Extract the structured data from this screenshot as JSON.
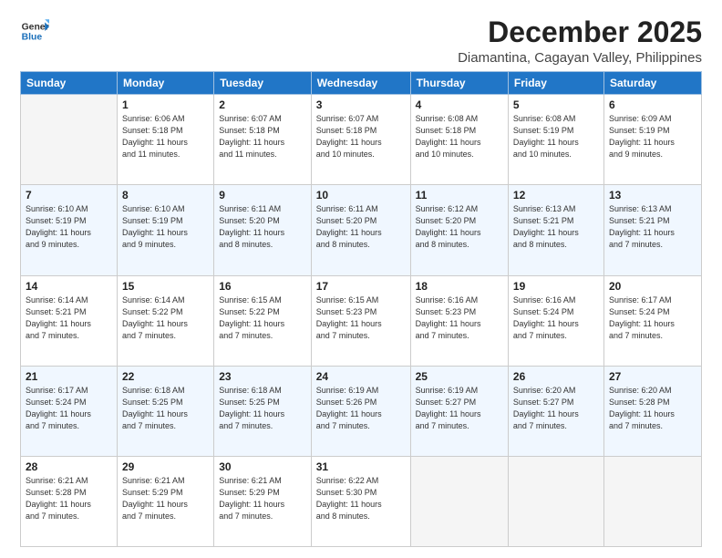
{
  "header": {
    "logo_general": "General",
    "logo_blue": "Blue",
    "month": "December 2025",
    "location": "Diamantina, Cagayan Valley, Philippines"
  },
  "days_of_week": [
    "Sunday",
    "Monday",
    "Tuesday",
    "Wednesday",
    "Thursday",
    "Friday",
    "Saturday"
  ],
  "weeks": [
    [
      {
        "day": "",
        "info": ""
      },
      {
        "day": "1",
        "info": "Sunrise: 6:06 AM\nSunset: 5:18 PM\nDaylight: 11 hours\nand 11 minutes."
      },
      {
        "day": "2",
        "info": "Sunrise: 6:07 AM\nSunset: 5:18 PM\nDaylight: 11 hours\nand 11 minutes."
      },
      {
        "day": "3",
        "info": "Sunrise: 6:07 AM\nSunset: 5:18 PM\nDaylight: 11 hours\nand 10 minutes."
      },
      {
        "day": "4",
        "info": "Sunrise: 6:08 AM\nSunset: 5:18 PM\nDaylight: 11 hours\nand 10 minutes."
      },
      {
        "day": "5",
        "info": "Sunrise: 6:08 AM\nSunset: 5:19 PM\nDaylight: 11 hours\nand 10 minutes."
      },
      {
        "day": "6",
        "info": "Sunrise: 6:09 AM\nSunset: 5:19 PM\nDaylight: 11 hours\nand 9 minutes."
      }
    ],
    [
      {
        "day": "7",
        "info": "Sunrise: 6:10 AM\nSunset: 5:19 PM\nDaylight: 11 hours\nand 9 minutes."
      },
      {
        "day": "8",
        "info": "Sunrise: 6:10 AM\nSunset: 5:19 PM\nDaylight: 11 hours\nand 9 minutes."
      },
      {
        "day": "9",
        "info": "Sunrise: 6:11 AM\nSunset: 5:20 PM\nDaylight: 11 hours\nand 8 minutes."
      },
      {
        "day": "10",
        "info": "Sunrise: 6:11 AM\nSunset: 5:20 PM\nDaylight: 11 hours\nand 8 minutes."
      },
      {
        "day": "11",
        "info": "Sunrise: 6:12 AM\nSunset: 5:20 PM\nDaylight: 11 hours\nand 8 minutes."
      },
      {
        "day": "12",
        "info": "Sunrise: 6:13 AM\nSunset: 5:21 PM\nDaylight: 11 hours\nand 8 minutes."
      },
      {
        "day": "13",
        "info": "Sunrise: 6:13 AM\nSunset: 5:21 PM\nDaylight: 11 hours\nand 7 minutes."
      }
    ],
    [
      {
        "day": "14",
        "info": "Sunrise: 6:14 AM\nSunset: 5:21 PM\nDaylight: 11 hours\nand 7 minutes."
      },
      {
        "day": "15",
        "info": "Sunrise: 6:14 AM\nSunset: 5:22 PM\nDaylight: 11 hours\nand 7 minutes."
      },
      {
        "day": "16",
        "info": "Sunrise: 6:15 AM\nSunset: 5:22 PM\nDaylight: 11 hours\nand 7 minutes."
      },
      {
        "day": "17",
        "info": "Sunrise: 6:15 AM\nSunset: 5:23 PM\nDaylight: 11 hours\nand 7 minutes."
      },
      {
        "day": "18",
        "info": "Sunrise: 6:16 AM\nSunset: 5:23 PM\nDaylight: 11 hours\nand 7 minutes."
      },
      {
        "day": "19",
        "info": "Sunrise: 6:16 AM\nSunset: 5:24 PM\nDaylight: 11 hours\nand 7 minutes."
      },
      {
        "day": "20",
        "info": "Sunrise: 6:17 AM\nSunset: 5:24 PM\nDaylight: 11 hours\nand 7 minutes."
      }
    ],
    [
      {
        "day": "21",
        "info": "Sunrise: 6:17 AM\nSunset: 5:24 PM\nDaylight: 11 hours\nand 7 minutes."
      },
      {
        "day": "22",
        "info": "Sunrise: 6:18 AM\nSunset: 5:25 PM\nDaylight: 11 hours\nand 7 minutes."
      },
      {
        "day": "23",
        "info": "Sunrise: 6:18 AM\nSunset: 5:25 PM\nDaylight: 11 hours\nand 7 minutes."
      },
      {
        "day": "24",
        "info": "Sunrise: 6:19 AM\nSunset: 5:26 PM\nDaylight: 11 hours\nand 7 minutes."
      },
      {
        "day": "25",
        "info": "Sunrise: 6:19 AM\nSunset: 5:27 PM\nDaylight: 11 hours\nand 7 minutes."
      },
      {
        "day": "26",
        "info": "Sunrise: 6:20 AM\nSunset: 5:27 PM\nDaylight: 11 hours\nand 7 minutes."
      },
      {
        "day": "27",
        "info": "Sunrise: 6:20 AM\nSunset: 5:28 PM\nDaylight: 11 hours\nand 7 minutes."
      }
    ],
    [
      {
        "day": "28",
        "info": "Sunrise: 6:21 AM\nSunset: 5:28 PM\nDaylight: 11 hours\nand 7 minutes."
      },
      {
        "day": "29",
        "info": "Sunrise: 6:21 AM\nSunset: 5:29 PM\nDaylight: 11 hours\nand 7 minutes."
      },
      {
        "day": "30",
        "info": "Sunrise: 6:21 AM\nSunset: 5:29 PM\nDaylight: 11 hours\nand 7 minutes."
      },
      {
        "day": "31",
        "info": "Sunrise: 6:22 AM\nSunset: 5:30 PM\nDaylight: 11 hours\nand 8 minutes."
      },
      {
        "day": "",
        "info": ""
      },
      {
        "day": "",
        "info": ""
      },
      {
        "day": "",
        "info": ""
      }
    ]
  ]
}
